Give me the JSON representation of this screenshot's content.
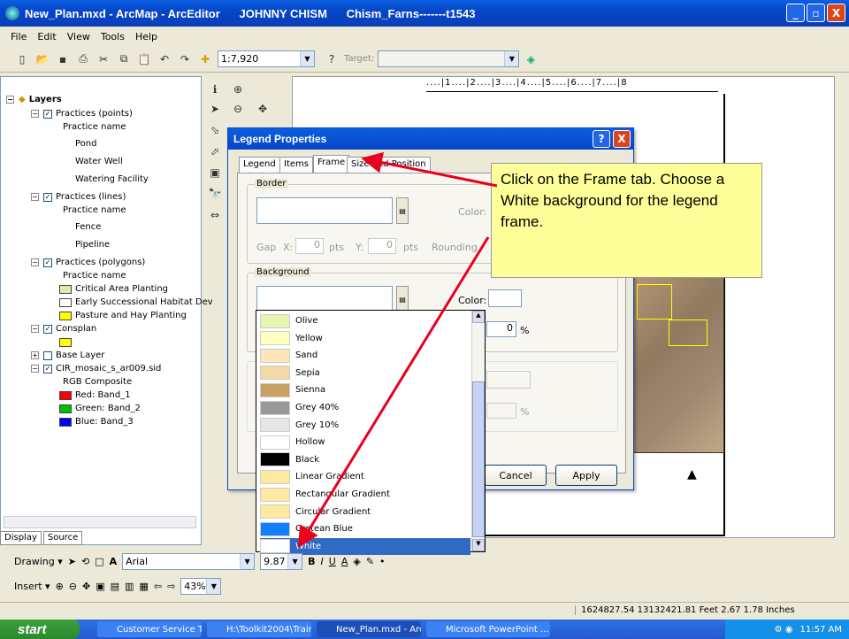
{
  "window": {
    "title": "New_Plan.mxd - ArcMap - ArcEditor      JOHNNY CHISM      Chism_Farns-------t1543",
    "min": "_",
    "max": "▫",
    "close": "X"
  },
  "menu": [
    "File",
    "Edit",
    "View",
    "Tools",
    "Help"
  ],
  "toolbar": {
    "scale": "1:7,920",
    "target_label": "Target:"
  },
  "toc": {
    "root": "Layers",
    "items": [
      {
        "label": "Practices (points)",
        "kind": "group",
        "checked": true
      },
      {
        "label": "Practice name",
        "kind": "sub"
      },
      {
        "label": "Pond",
        "kind": "sym"
      },
      {
        "label": "Water Well",
        "kind": "sym"
      },
      {
        "label": "Watering Facility",
        "kind": "sym"
      },
      {
        "label": "Practices (lines)",
        "kind": "group",
        "checked": true
      },
      {
        "label": "Practice name",
        "kind": "sub"
      },
      {
        "label": "Fence",
        "kind": "sym"
      },
      {
        "label": "Pipeline",
        "kind": "sym"
      },
      {
        "label": "Practices (polygons)",
        "kind": "group",
        "checked": true
      },
      {
        "label": "Practice name",
        "kind": "sub"
      },
      {
        "label": "Critical Area Planting",
        "kind": "sym",
        "color": "#d6f0a8"
      },
      {
        "label": "Early Successional Habitat Dev",
        "kind": "sym",
        "color": "#ffffff"
      },
      {
        "label": "Pasture and Hay Planting",
        "kind": "sym",
        "color": "#ffff00"
      },
      {
        "label": "Consplan",
        "kind": "group",
        "checked": true
      },
      {
        "label": "",
        "kind": "sym",
        "color": "#ffff00"
      },
      {
        "label": "Base Layer",
        "kind": "group",
        "checked": false
      },
      {
        "label": "CIR_mosaic_s_ar009.sid",
        "kind": "group",
        "checked": true
      },
      {
        "label": "RGB Composite",
        "kind": "sub"
      },
      {
        "label": "Red:   Band_1",
        "kind": "sym",
        "color": "#ff0000"
      },
      {
        "label": "Green: Band_2",
        "kind": "sym",
        "color": "#00c000"
      },
      {
        "label": "Blue:  Band_3",
        "kind": "sym",
        "color": "#0000ff"
      }
    ],
    "tabs": [
      "Display",
      "Source"
    ]
  },
  "ruler": "....|1....|2....|3....|4....|5....|6....|7....|8",
  "dialog": {
    "title": "Legend Properties",
    "tabs": [
      "Legend",
      "Items",
      "Frame",
      "Size and Position"
    ],
    "border_label": "Border",
    "color_label": "Color:",
    "gap_label": "Gap",
    "x_label": "X:",
    "y_label": "Y:",
    "gap_x": "0",
    "gap_y": "0",
    "pts": "pts",
    "rounding": "Rounding",
    "background_label": "Background",
    "pct_value": "0",
    "pct": "%",
    "cancel": "Cancel",
    "apply": "Apply"
  },
  "dropdown": {
    "items": [
      {
        "label": "Olive",
        "color": "#e6f5b0"
      },
      {
        "label": "Yellow",
        "color": "#ffffc0"
      },
      {
        "label": "Sand",
        "color": "#fde6b8"
      },
      {
        "label": "Sepia",
        "color": "#f4d9a6"
      },
      {
        "label": "Sienna",
        "color": "#c8a060"
      },
      {
        "label": "Grey 40%",
        "color": "#999999"
      },
      {
        "label": "Grey 10%",
        "color": "#e6e6e6"
      },
      {
        "label": "Hollow",
        "color": "#ffffff"
      },
      {
        "label": "Black",
        "color": "#000000"
      },
      {
        "label": "Linear Gradient",
        "color": "#ffe8a0"
      },
      {
        "label": "Rectangular Gradient",
        "color": "#ffe8a0"
      },
      {
        "label": "Circular Gradient",
        "color": "#ffe8a0"
      },
      {
        "label": "Cretean Blue",
        "color": "#1080ff"
      },
      {
        "label": "White",
        "color": "#ffffff",
        "selected": true
      }
    ]
  },
  "callout": "Click on the Frame tab. Choose a White background for the legend frame.",
  "drawbar": {
    "drawing": "Drawing ▾",
    "font": "Arial",
    "size": "9.87"
  },
  "insertbar": {
    "insert": "Insert ▾",
    "zoom": "43%"
  },
  "status": "1624827.54  13132421.81 Feet  2.67  1.78 Inches",
  "taskbar": {
    "start": "start",
    "tasks": [
      "Customer Service To...",
      "H:\\Toolkit2004\\Traini...",
      "New_Plan.mxd - Arc...",
      "Microsoft PowerPoint ..."
    ],
    "clock": "11:57 AM"
  },
  "colors": {
    "accent": "#0a46c8",
    "callout": "#ffff99",
    "arrow": "#e8001c"
  }
}
